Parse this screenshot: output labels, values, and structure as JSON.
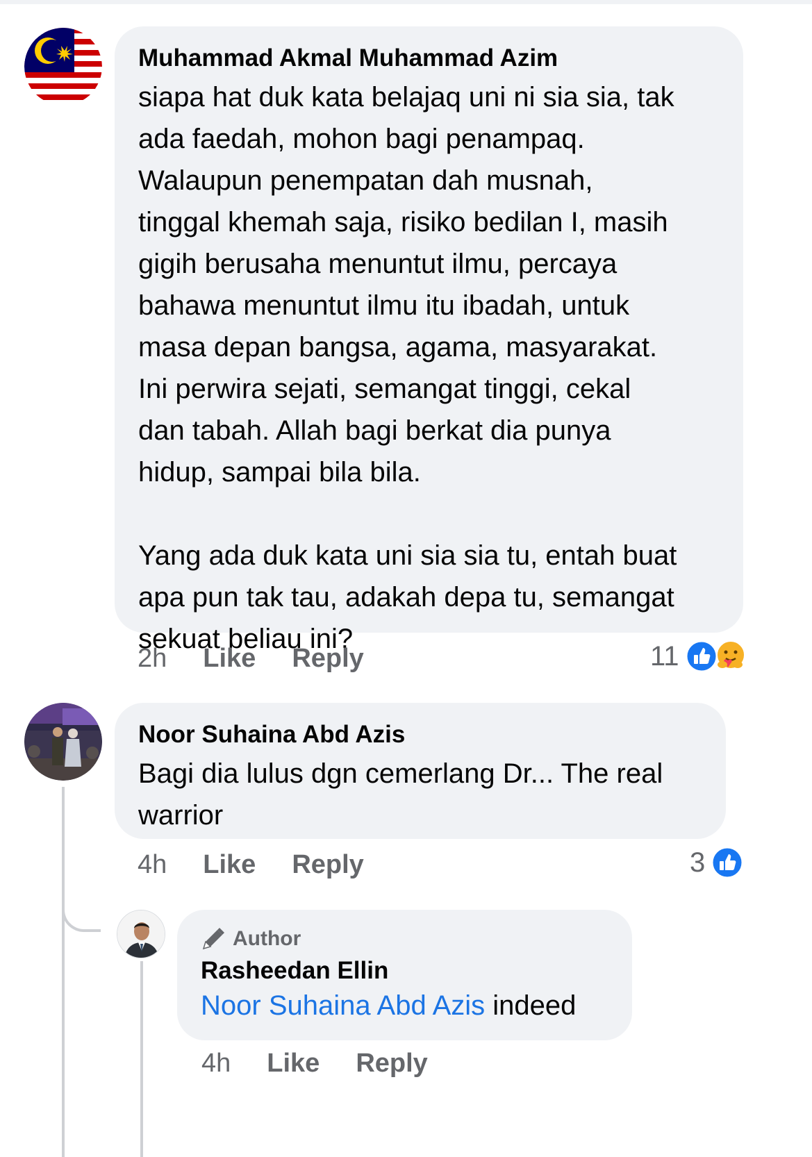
{
  "comments": [
    {
      "author": "Muhammad Akmal Muhammad Azim",
      "text": "siapa hat duk kata belajaq uni ni sia sia, tak\nada faedah, mohon bagi penampaq.\nWalaupun penempatan dah musnah,\ntinggal khemah saja, risiko bedilan I, masih\ngigih berusaha menuntut ilmu, percaya\nbahawa menuntut ilmu itu ibadah, untuk\nmasa depan bangsa, agama, masyarakat.\nIni perwira sejati, semangat tinggi, cekal\ndan tabah. Allah bagi berkat dia punya\nhidup, sampai bila bila.\n\nYang ada duk kata uni sia sia tu, entah buat\napa pun tak tau, adakah depa tu, semangat\nsekuat beliau ini?",
      "time": "2h",
      "like_label": "Like",
      "reply_label": "Reply",
      "reaction_count": "11",
      "reactions": [
        "like-icon",
        "care-icon"
      ]
    },
    {
      "author": "Noor Suhaina Abd Azis",
      "text": "Bagi dia lulus dgn cemerlang Dr... The real\nwarrior",
      "time": "4h",
      "like_label": "Like",
      "reply_label": "Reply",
      "reaction_count": "3",
      "reactions": [
        "like-icon"
      ]
    }
  ],
  "reply": {
    "badge": "Author",
    "author": "Rasheedan Ellin",
    "mention": "Noor Suhaina Abd Azis",
    "text": " indeed",
    "time": "4h",
    "like_label": "Like",
    "reply_label": "Reply"
  },
  "colors": {
    "bubble": "#f0f2f5",
    "meta": "#65676b",
    "link": "#1b74e4",
    "like_blue": "#1877f2"
  }
}
